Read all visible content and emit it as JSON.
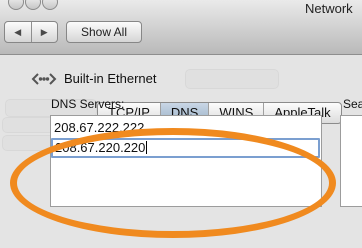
{
  "window": {
    "title": "Network"
  },
  "toolbar": {
    "back_glyph": "◀",
    "forward_glyph": "▶",
    "show_all_label": "Show All"
  },
  "interface": {
    "name": "Built-in Ethernet",
    "icon": "ethernet-icon"
  },
  "tabs": [
    {
      "label": "TCP/IP",
      "active": false
    },
    {
      "label": "DNS",
      "active": true
    },
    {
      "label": "WINS",
      "active": false
    },
    {
      "label": "AppleTalk",
      "active": false
    }
  ],
  "dns": {
    "label": "DNS Servers:",
    "servers": [
      "208.67.222.222",
      "208.67.220.220"
    ]
  },
  "search_domains": {
    "label_partial": "Sea"
  },
  "colors": {
    "annotation_oval": "#f08a1f",
    "active_tab": "#9cb2c8"
  }
}
